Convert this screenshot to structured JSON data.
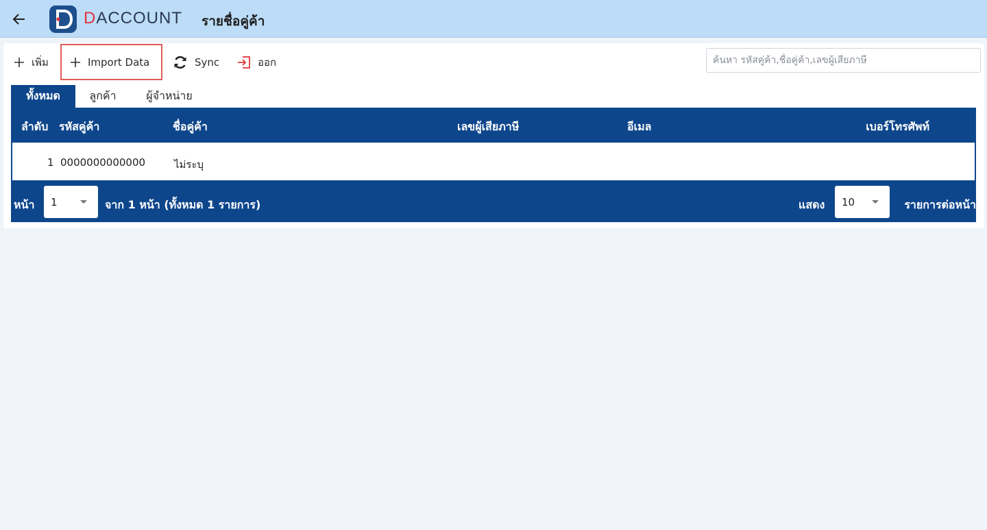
{
  "appbar": {
    "brand_prefix": "D",
    "brand_rest": "ACCOUNT",
    "title": "รายชื่อคู่ค้า",
    "back_icon": "arrow-left-icon"
  },
  "toolbar": {
    "add_label": "เพิ่ม",
    "import_label": "Import Data",
    "sync_label": "Sync",
    "exit_label": "ออก",
    "exit_icon_color": "#e3323c"
  },
  "search": {
    "placeholder": "ค้นหา รหัสคู่ค้า,ชื่อคู่ค้า,เลขผู้เสียภาษี"
  },
  "tabs": [
    {
      "label": "ทั้งหมด",
      "active": true
    },
    {
      "label": "ลูกค้า",
      "active": false
    },
    {
      "label": "ผู้จำหน่าย",
      "active": false
    }
  ],
  "table": {
    "columns": {
      "index": "ลำดับ",
      "code": "รหัสคู่ค้า",
      "name": "ชื่อคู่ค้า",
      "tax_id": "เลขผู้เสียภาษี",
      "email": "อีเมล",
      "phone": "เบอร์โทรศัพท์"
    },
    "rows": [
      {
        "index": "1",
        "code": "0000000000000",
        "name": "ไม่ระบุ",
        "tax_id": "",
        "email": "",
        "phone": ""
      }
    ]
  },
  "pagination": {
    "page_label": "หน้า",
    "page_value": "1",
    "summary": "จาก 1 หน้า (ทั้งหมด 1 รายการ)",
    "show_label": "แสดง",
    "per_page_value": "10",
    "per_page_suffix": "รายการต่อหน้า"
  },
  "colors": {
    "appbar": "#bcdcf7",
    "primary": "#0e468c",
    "accent": "#e3323c",
    "highlight_border": "#e25b57"
  }
}
